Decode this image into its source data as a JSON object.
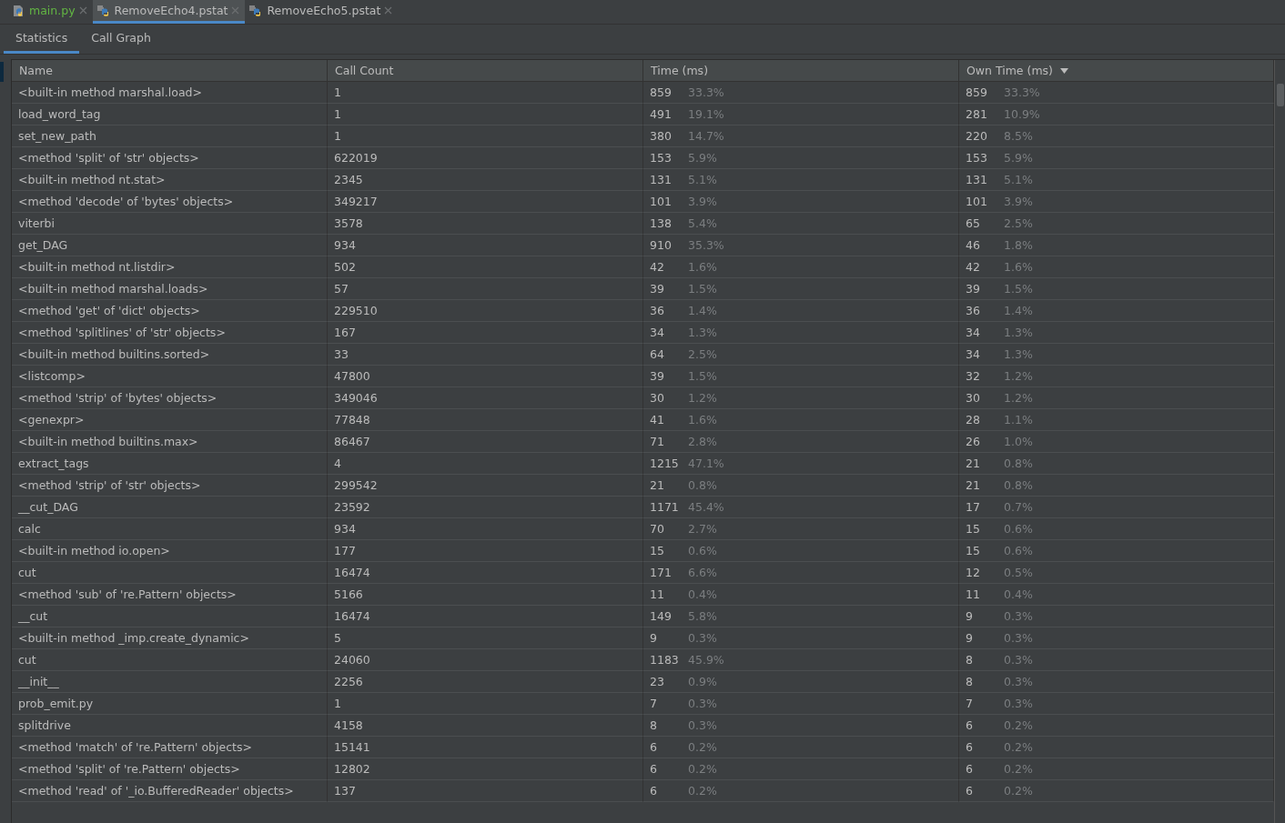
{
  "editor_tabs": [
    {
      "label": "main.py",
      "kind": "python",
      "selected": false,
      "color": "#62b543"
    },
    {
      "label": "RemoveEcho4.pstat",
      "kind": "profile",
      "selected": true,
      "color": "#bbbbbb"
    },
    {
      "label": "RemoveEcho5.pstat",
      "kind": "profile",
      "selected": false,
      "color": "#bbbbbb"
    }
  ],
  "view_tabs": [
    {
      "label": "Statistics",
      "selected": true
    },
    {
      "label": "Call Graph",
      "selected": false
    }
  ],
  "table": {
    "columns": [
      {
        "label": "Name",
        "sorted": false
      },
      {
        "label": "Call Count",
        "sorted": false
      },
      {
        "label": "Time (ms)",
        "sorted": false
      },
      {
        "label": "Own Time (ms)",
        "sorted": true
      }
    ],
    "rows": [
      {
        "name": "<built-in method marshal.load>",
        "calls": "1",
        "time": "859",
        "time_pct": "33.3%",
        "own": "859",
        "own_pct": "33.3%"
      },
      {
        "name": "load_word_tag",
        "calls": "1",
        "time": "491",
        "time_pct": "19.1%",
        "own": "281",
        "own_pct": "10.9%"
      },
      {
        "name": "set_new_path",
        "calls": "1",
        "time": "380",
        "time_pct": "14.7%",
        "own": "220",
        "own_pct": "8.5%"
      },
      {
        "name": "<method 'split' of 'str' objects>",
        "calls": "622019",
        "time": "153",
        "time_pct": "5.9%",
        "own": "153",
        "own_pct": "5.9%"
      },
      {
        "name": "<built-in method nt.stat>",
        "calls": "2345",
        "time": "131",
        "time_pct": "5.1%",
        "own": "131",
        "own_pct": "5.1%"
      },
      {
        "name": "<method 'decode' of 'bytes' objects>",
        "calls": "349217",
        "time": "101",
        "time_pct": "3.9%",
        "own": "101",
        "own_pct": "3.9%"
      },
      {
        "name": "viterbi",
        "calls": "3578",
        "time": "138",
        "time_pct": "5.4%",
        "own": "65",
        "own_pct": "2.5%"
      },
      {
        "name": "get_DAG",
        "calls": "934",
        "time": "910",
        "time_pct": "35.3%",
        "own": "46",
        "own_pct": "1.8%"
      },
      {
        "name": "<built-in method nt.listdir>",
        "calls": "502",
        "time": "42",
        "time_pct": "1.6%",
        "own": "42",
        "own_pct": "1.6%"
      },
      {
        "name": "<built-in method marshal.loads>",
        "calls": "57",
        "time": "39",
        "time_pct": "1.5%",
        "own": "39",
        "own_pct": "1.5%"
      },
      {
        "name": "<method 'get' of 'dict' objects>",
        "calls": "229510",
        "time": "36",
        "time_pct": "1.4%",
        "own": "36",
        "own_pct": "1.4%"
      },
      {
        "name": "<method 'splitlines' of 'str' objects>",
        "calls": "167",
        "time": "34",
        "time_pct": "1.3%",
        "own": "34",
        "own_pct": "1.3%"
      },
      {
        "name": "<built-in method builtins.sorted>",
        "calls": "33",
        "time": "64",
        "time_pct": "2.5%",
        "own": "34",
        "own_pct": "1.3%"
      },
      {
        "name": "<listcomp>",
        "calls": "47800",
        "time": "39",
        "time_pct": "1.5%",
        "own": "32",
        "own_pct": "1.2%"
      },
      {
        "name": "<method 'strip' of 'bytes' objects>",
        "calls": "349046",
        "time": "30",
        "time_pct": "1.2%",
        "own": "30",
        "own_pct": "1.2%"
      },
      {
        "name": "<genexpr>",
        "calls": "77848",
        "time": "41",
        "time_pct": "1.6%",
        "own": "28",
        "own_pct": "1.1%"
      },
      {
        "name": "<built-in method builtins.max>",
        "calls": "86467",
        "time": "71",
        "time_pct": "2.8%",
        "own": "26",
        "own_pct": "1.0%"
      },
      {
        "name": "extract_tags",
        "calls": "4",
        "time": "1215",
        "time_pct": "47.1%",
        "own": "21",
        "own_pct": "0.8%"
      },
      {
        "name": "<method 'strip' of 'str' objects>",
        "calls": "299542",
        "time": "21",
        "time_pct": "0.8%",
        "own": "21",
        "own_pct": "0.8%"
      },
      {
        "name": "__cut_DAG",
        "calls": "23592",
        "time": "1171",
        "time_pct": "45.4%",
        "own": "17",
        "own_pct": "0.7%"
      },
      {
        "name": "calc",
        "calls": "934",
        "time": "70",
        "time_pct": "2.7%",
        "own": "15",
        "own_pct": "0.6%"
      },
      {
        "name": "<built-in method io.open>",
        "calls": "177",
        "time": "15",
        "time_pct": "0.6%",
        "own": "15",
        "own_pct": "0.6%"
      },
      {
        "name": "cut",
        "calls": "16474",
        "time": "171",
        "time_pct": "6.6%",
        "own": "12",
        "own_pct": "0.5%"
      },
      {
        "name": "<method 'sub' of 're.Pattern' objects>",
        "calls": "5166",
        "time": "11",
        "time_pct": "0.4%",
        "own": "11",
        "own_pct": "0.4%"
      },
      {
        "name": "__cut",
        "calls": "16474",
        "time": "149",
        "time_pct": "5.8%",
        "own": "9",
        "own_pct": "0.3%"
      },
      {
        "name": "<built-in method _imp.create_dynamic>",
        "calls": "5",
        "time": "9",
        "time_pct": "0.3%",
        "own": "9",
        "own_pct": "0.3%"
      },
      {
        "name": "cut",
        "calls": "24060",
        "time": "1183",
        "time_pct": "45.9%",
        "own": "8",
        "own_pct": "0.3%"
      },
      {
        "name": "__init__",
        "calls": "2256",
        "time": "23",
        "time_pct": "0.9%",
        "own": "8",
        "own_pct": "0.3%"
      },
      {
        "name": "prob_emit.py",
        "calls": "1",
        "time": "7",
        "time_pct": "0.3%",
        "own": "7",
        "own_pct": "0.3%"
      },
      {
        "name": "splitdrive",
        "calls": "4158",
        "time": "8",
        "time_pct": "0.3%",
        "own": "6",
        "own_pct": "0.2%"
      },
      {
        "name": "<method 'match' of 're.Pattern' objects>",
        "calls": "15141",
        "time": "6",
        "time_pct": "0.2%",
        "own": "6",
        "own_pct": "0.2%"
      },
      {
        "name": "<method 'split' of 're.Pattern' objects>",
        "calls": "12802",
        "time": "6",
        "time_pct": "0.2%",
        "own": "6",
        "own_pct": "0.2%"
      },
      {
        "name": "<method 'read' of '_io.BufferedReader' objects>",
        "calls": "137",
        "time": "6",
        "time_pct": "0.2%",
        "own": "6",
        "own_pct": "0.2%"
      }
    ]
  }
}
